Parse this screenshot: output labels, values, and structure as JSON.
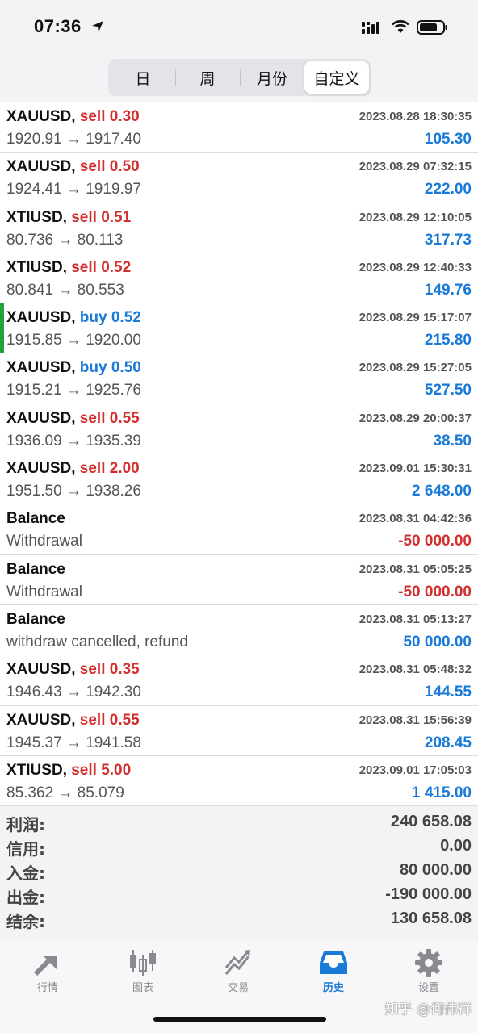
{
  "status_bar": {
    "time": "07:36"
  },
  "segments": [
    {
      "label": "日",
      "active": false
    },
    {
      "label": "周",
      "active": false
    },
    {
      "label": "月份",
      "active": false
    },
    {
      "label": "自定义",
      "active": true
    }
  ],
  "rows": [
    {
      "symbol": "XAUUSD,",
      "action": "sell 0.30",
      "side": "sell",
      "time": "2023.08.28 18:30:35",
      "detail": "1920.91 → 1917.40",
      "amount": "105.30",
      "amount_sign": "pos"
    },
    {
      "symbol": "XAUUSD,",
      "action": "sell 0.50",
      "side": "sell",
      "time": "2023.08.29 07:32:15",
      "detail": "1924.41 → 1919.97",
      "amount": "222.00",
      "amount_sign": "pos"
    },
    {
      "symbol": "XTIUSD,",
      "action": "sell 0.51",
      "side": "sell",
      "time": "2023.08.29 12:10:05",
      "detail": "80.736 → 80.113",
      "amount": "317.73",
      "amount_sign": "pos"
    },
    {
      "symbol": "XTIUSD,",
      "action": "sell 0.52",
      "side": "sell",
      "time": "2023.08.29 12:40:33",
      "detail": "80.841 → 80.553",
      "amount": "149.76",
      "amount_sign": "pos"
    },
    {
      "symbol": "XAUUSD,",
      "action": "buy 0.52",
      "side": "buy",
      "time": "2023.08.29 15:17:07",
      "detail": "1915.85 → 1920.00",
      "amount": "215.80",
      "amount_sign": "pos",
      "accent": true
    },
    {
      "symbol": "XAUUSD,",
      "action": "buy 0.50",
      "side": "buy",
      "time": "2023.08.29 15:27:05",
      "detail": "1915.21 → 1925.76",
      "amount": "527.50",
      "amount_sign": "pos"
    },
    {
      "symbol": "XAUUSD,",
      "action": "sell 0.55",
      "side": "sell",
      "time": "2023.08.29 20:00:37",
      "detail": "1936.09 → 1935.39",
      "amount": "38.50",
      "amount_sign": "pos"
    },
    {
      "symbol": "XAUUSD,",
      "action": "sell 2.00",
      "side": "sell",
      "time": "2023.09.01 15:30:31",
      "detail": "1951.50 → 1938.26",
      "amount": "2 648.00",
      "amount_sign": "pos"
    },
    {
      "symbol": "Balance",
      "action": "",
      "side": "",
      "time": "2023.08.31 04:42:36",
      "detail": "Withdrawal",
      "amount": "-50 000.00",
      "amount_sign": "neg"
    },
    {
      "symbol": "Balance",
      "action": "",
      "side": "",
      "time": "2023.08.31 05:05:25",
      "detail": "Withdrawal",
      "amount": "-50 000.00",
      "amount_sign": "neg"
    },
    {
      "symbol": "Balance",
      "action": "",
      "side": "",
      "time": "2023.08.31 05:13:27",
      "detail": "withdraw cancelled, refund",
      "amount": "50 000.00",
      "amount_sign": "pos"
    },
    {
      "symbol": "XAUUSD,",
      "action": "sell 0.35",
      "side": "sell",
      "time": "2023.08.31 05:48:32",
      "detail": "1946.43 → 1942.30",
      "amount": "144.55",
      "amount_sign": "pos"
    },
    {
      "symbol": "XAUUSD,",
      "action": "sell 0.55",
      "side": "sell",
      "time": "2023.08.31 15:56:39",
      "detail": "1945.37 → 1941.58",
      "amount": "208.45",
      "amount_sign": "pos"
    },
    {
      "symbol": "XTIUSD,",
      "action": "sell 5.00",
      "side": "sell",
      "time": "2023.09.01 17:05:03",
      "detail": "85.362 → 85.079",
      "amount": "1 415.00",
      "amount_sign": "pos"
    }
  ],
  "summary": [
    {
      "label": "利润:",
      "value": "240 658.08"
    },
    {
      "label": "信用:",
      "value": "0.00"
    },
    {
      "label": "入金:",
      "value": "80 000.00"
    },
    {
      "label": "出金:",
      "value": "-190 000.00"
    },
    {
      "label": "结余:",
      "value": "130 658.08"
    }
  ],
  "tabs": [
    {
      "label": "行情",
      "icon": "quotes-arrows-icon",
      "active": false
    },
    {
      "label": "图表",
      "icon": "candlestick-chart-icon",
      "active": false
    },
    {
      "label": "交易",
      "icon": "trade-chart-icon",
      "active": false
    },
    {
      "label": "历史",
      "icon": "history-inbox-icon",
      "active": true
    },
    {
      "label": "设置",
      "icon": "gear-icon",
      "active": false
    }
  ],
  "watermark": "知乎 @何伟祥",
  "colors": {
    "sell": "#d32f2f",
    "buy": "#1a7ad8",
    "positive": "#1a7ad8",
    "negative": "#d32f2f",
    "accent_bar": "#1fa43b",
    "tab_active": "#1a7ad8",
    "tab_inactive": "#8a8a8e"
  }
}
